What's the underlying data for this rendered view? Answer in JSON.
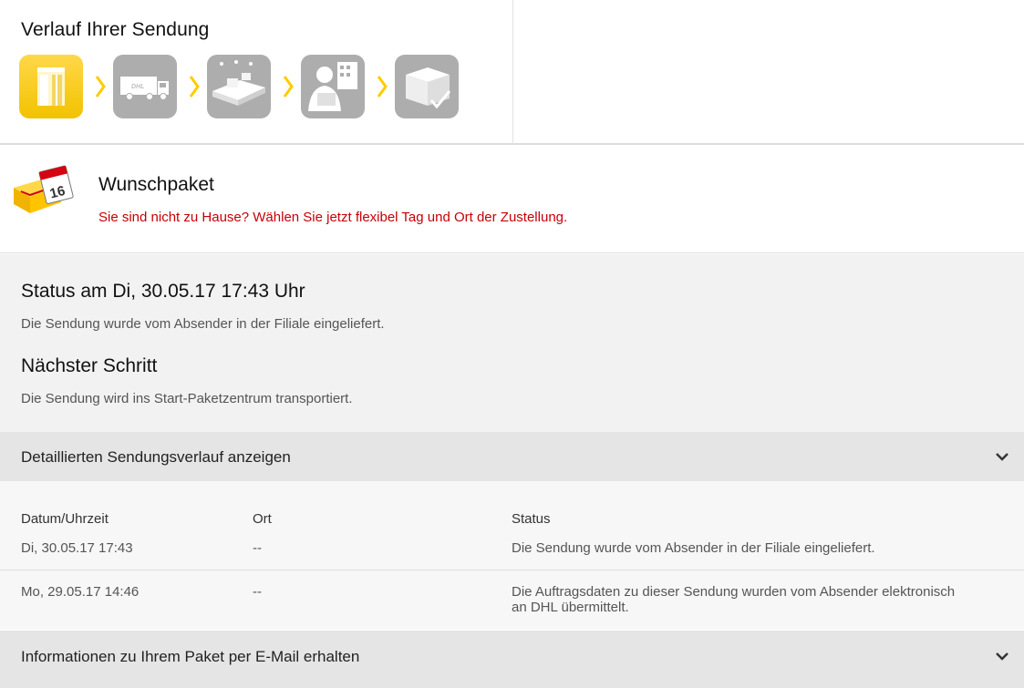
{
  "tracking": {
    "title": "Verlauf Ihrer Sendung",
    "steps": [
      {
        "icon": "post-office-icon",
        "active": true
      },
      {
        "icon": "delivery-truck-icon",
        "active": false
      },
      {
        "icon": "conveyor-belt-icon",
        "active": false
      },
      {
        "icon": "courier-icon",
        "active": false
      },
      {
        "icon": "package-delivered-icon",
        "active": false
      }
    ]
  },
  "wunschpaket": {
    "title": "Wunschpaket",
    "link": "Sie sind nicht zu Hause? Wählen Sie jetzt flexibel Tag und Ort der Zustellung.",
    "calendar_day": "16"
  },
  "status": {
    "heading": "Status am Di, 30.05.17 17:43 Uhr",
    "text": "Die Sendung wurde vom Absender in der Filiale eingeliefert.",
    "next_heading": "Nächster Schritt",
    "next_text": "Die Sendung wird ins Start-Paketzentrum transportiert."
  },
  "details_toggle": {
    "label": "Detaillierten Sendungsverlauf anzeigen"
  },
  "history": {
    "columns": [
      "Datum/Uhrzeit",
      "Ort",
      "Status"
    ],
    "rows": [
      {
        "date": "Di, 30.05.17 17:43",
        "place": "--",
        "status": "Die Sendung wurde vom Absender in der Filiale eingeliefert."
      },
      {
        "date": "Mo, 29.05.17 14:46",
        "place": "--",
        "status": "Die Auftragsdaten zu dieser Sendung wurden vom Absender elektronisch an DHL übermittelt."
      }
    ]
  },
  "email_toggle": {
    "label": "Informationen zu Ihrem Paket per E-Mail erhalten"
  },
  "colors": {
    "dhl_yellow": "#ffcc00",
    "link_red": "#c50006",
    "inactive_step": "#adadad"
  }
}
